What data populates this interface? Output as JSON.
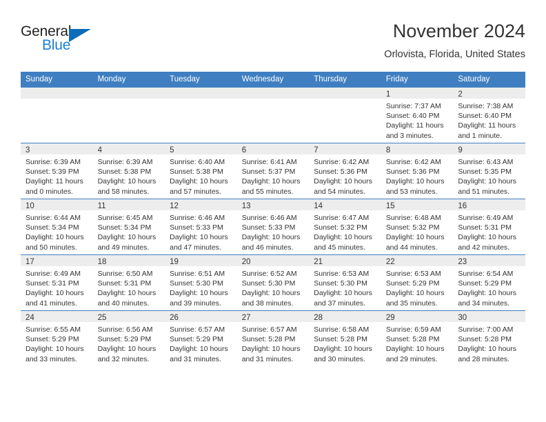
{
  "brand": {
    "name_part1": "General",
    "name_part2": "Blue",
    "accent_color": "#1b7fd4",
    "triangle_color": "#0d6cb9"
  },
  "header": {
    "title": "November 2024",
    "location": "Orlovista, Florida, United States"
  },
  "theme": {
    "header_blue": "#3f7fc1",
    "daynum_band": "#ededed",
    "text": "#333333"
  },
  "weekdays": [
    "Sunday",
    "Monday",
    "Tuesday",
    "Wednesday",
    "Thursday",
    "Friday",
    "Saturday"
  ],
  "weeks": [
    [
      {
        "day": "",
        "empty": true,
        "sunrise": "",
        "sunset": "",
        "daylight": ""
      },
      {
        "day": "",
        "empty": true,
        "sunrise": "",
        "sunset": "",
        "daylight": ""
      },
      {
        "day": "",
        "empty": true,
        "sunrise": "",
        "sunset": "",
        "daylight": ""
      },
      {
        "day": "",
        "empty": true,
        "sunrise": "",
        "sunset": "",
        "daylight": ""
      },
      {
        "day": "",
        "empty": true,
        "sunrise": "",
        "sunset": "",
        "daylight": ""
      },
      {
        "day": "1",
        "empty": false,
        "sunrise": "Sunrise: 7:37 AM",
        "sunset": "Sunset: 6:40 PM",
        "daylight": "Daylight: 11 hours and 3 minutes."
      },
      {
        "day": "2",
        "empty": false,
        "sunrise": "Sunrise: 7:38 AM",
        "sunset": "Sunset: 6:40 PM",
        "daylight": "Daylight: 11 hours and 1 minute."
      }
    ],
    [
      {
        "day": "3",
        "empty": false,
        "sunrise": "Sunrise: 6:39 AM",
        "sunset": "Sunset: 5:39 PM",
        "daylight": "Daylight: 11 hours and 0 minutes."
      },
      {
        "day": "4",
        "empty": false,
        "sunrise": "Sunrise: 6:39 AM",
        "sunset": "Sunset: 5:38 PM",
        "daylight": "Daylight: 10 hours and 58 minutes."
      },
      {
        "day": "5",
        "empty": false,
        "sunrise": "Sunrise: 6:40 AM",
        "sunset": "Sunset: 5:38 PM",
        "daylight": "Daylight: 10 hours and 57 minutes."
      },
      {
        "day": "6",
        "empty": false,
        "sunrise": "Sunrise: 6:41 AM",
        "sunset": "Sunset: 5:37 PM",
        "daylight": "Daylight: 10 hours and 55 minutes."
      },
      {
        "day": "7",
        "empty": false,
        "sunrise": "Sunrise: 6:42 AM",
        "sunset": "Sunset: 5:36 PM",
        "daylight": "Daylight: 10 hours and 54 minutes."
      },
      {
        "day": "8",
        "empty": false,
        "sunrise": "Sunrise: 6:42 AM",
        "sunset": "Sunset: 5:36 PM",
        "daylight": "Daylight: 10 hours and 53 minutes."
      },
      {
        "day": "9",
        "empty": false,
        "sunrise": "Sunrise: 6:43 AM",
        "sunset": "Sunset: 5:35 PM",
        "daylight": "Daylight: 10 hours and 51 minutes."
      }
    ],
    [
      {
        "day": "10",
        "empty": false,
        "sunrise": "Sunrise: 6:44 AM",
        "sunset": "Sunset: 5:34 PM",
        "daylight": "Daylight: 10 hours and 50 minutes."
      },
      {
        "day": "11",
        "empty": false,
        "sunrise": "Sunrise: 6:45 AM",
        "sunset": "Sunset: 5:34 PM",
        "daylight": "Daylight: 10 hours and 49 minutes."
      },
      {
        "day": "12",
        "empty": false,
        "sunrise": "Sunrise: 6:46 AM",
        "sunset": "Sunset: 5:33 PM",
        "daylight": "Daylight: 10 hours and 47 minutes."
      },
      {
        "day": "13",
        "empty": false,
        "sunrise": "Sunrise: 6:46 AM",
        "sunset": "Sunset: 5:33 PM",
        "daylight": "Daylight: 10 hours and 46 minutes."
      },
      {
        "day": "14",
        "empty": false,
        "sunrise": "Sunrise: 6:47 AM",
        "sunset": "Sunset: 5:32 PM",
        "daylight": "Daylight: 10 hours and 45 minutes."
      },
      {
        "day": "15",
        "empty": false,
        "sunrise": "Sunrise: 6:48 AM",
        "sunset": "Sunset: 5:32 PM",
        "daylight": "Daylight: 10 hours and 44 minutes."
      },
      {
        "day": "16",
        "empty": false,
        "sunrise": "Sunrise: 6:49 AM",
        "sunset": "Sunset: 5:31 PM",
        "daylight": "Daylight: 10 hours and 42 minutes."
      }
    ],
    [
      {
        "day": "17",
        "empty": false,
        "sunrise": "Sunrise: 6:49 AM",
        "sunset": "Sunset: 5:31 PM",
        "daylight": "Daylight: 10 hours and 41 minutes."
      },
      {
        "day": "18",
        "empty": false,
        "sunrise": "Sunrise: 6:50 AM",
        "sunset": "Sunset: 5:31 PM",
        "daylight": "Daylight: 10 hours and 40 minutes."
      },
      {
        "day": "19",
        "empty": false,
        "sunrise": "Sunrise: 6:51 AM",
        "sunset": "Sunset: 5:30 PM",
        "daylight": "Daylight: 10 hours and 39 minutes."
      },
      {
        "day": "20",
        "empty": false,
        "sunrise": "Sunrise: 6:52 AM",
        "sunset": "Sunset: 5:30 PM",
        "daylight": "Daylight: 10 hours and 38 minutes."
      },
      {
        "day": "21",
        "empty": false,
        "sunrise": "Sunrise: 6:53 AM",
        "sunset": "Sunset: 5:30 PM",
        "daylight": "Daylight: 10 hours and 37 minutes."
      },
      {
        "day": "22",
        "empty": false,
        "sunrise": "Sunrise: 6:53 AM",
        "sunset": "Sunset: 5:29 PM",
        "daylight": "Daylight: 10 hours and 35 minutes."
      },
      {
        "day": "23",
        "empty": false,
        "sunrise": "Sunrise: 6:54 AM",
        "sunset": "Sunset: 5:29 PM",
        "daylight": "Daylight: 10 hours and 34 minutes."
      }
    ],
    [
      {
        "day": "24",
        "empty": false,
        "sunrise": "Sunrise: 6:55 AM",
        "sunset": "Sunset: 5:29 PM",
        "daylight": "Daylight: 10 hours and 33 minutes."
      },
      {
        "day": "25",
        "empty": false,
        "sunrise": "Sunrise: 6:56 AM",
        "sunset": "Sunset: 5:29 PM",
        "daylight": "Daylight: 10 hours and 32 minutes."
      },
      {
        "day": "26",
        "empty": false,
        "sunrise": "Sunrise: 6:57 AM",
        "sunset": "Sunset: 5:29 PM",
        "daylight": "Daylight: 10 hours and 31 minutes."
      },
      {
        "day": "27",
        "empty": false,
        "sunrise": "Sunrise: 6:57 AM",
        "sunset": "Sunset: 5:28 PM",
        "daylight": "Daylight: 10 hours and 31 minutes."
      },
      {
        "day": "28",
        "empty": false,
        "sunrise": "Sunrise: 6:58 AM",
        "sunset": "Sunset: 5:28 PM",
        "daylight": "Daylight: 10 hours and 30 minutes."
      },
      {
        "day": "29",
        "empty": false,
        "sunrise": "Sunrise: 6:59 AM",
        "sunset": "Sunset: 5:28 PM",
        "daylight": "Daylight: 10 hours and 29 minutes."
      },
      {
        "day": "30",
        "empty": false,
        "sunrise": "Sunrise: 7:00 AM",
        "sunset": "Sunset: 5:28 PM",
        "daylight": "Daylight: 10 hours and 28 minutes."
      }
    ]
  ]
}
